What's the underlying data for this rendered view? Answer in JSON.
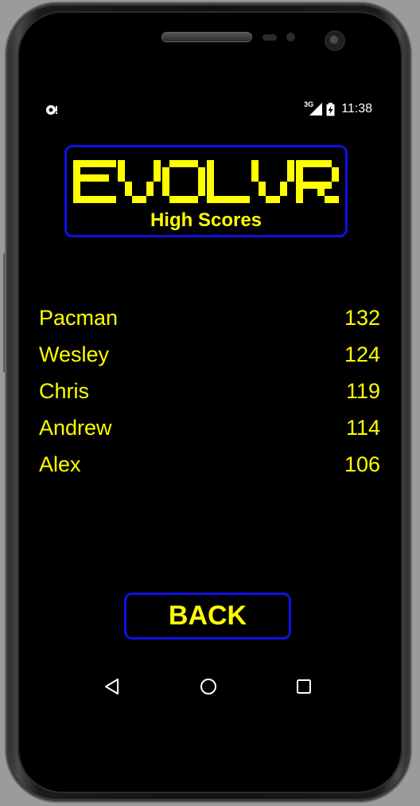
{
  "status_bar": {
    "left_icon": "debug-notification-icon",
    "network_label": "3G",
    "signal_icon": "signal-icon",
    "battery_icon": "battery-charging-icon",
    "time": "11:38"
  },
  "header": {
    "logo_text": "EVOLVR",
    "subtitle": "High Scores",
    "accent_color": "#ffff00",
    "border_color": "#1010e8"
  },
  "scores": [
    {
      "name": "Pacman",
      "score": "132"
    },
    {
      "name": "Wesley",
      "score": "124"
    },
    {
      "name": "Chris",
      "score": "119"
    },
    {
      "name": "Andrew",
      "score": "114"
    },
    {
      "name": "Alex",
      "score": "106"
    }
  ],
  "back_button": {
    "label": "BACK"
  },
  "nav_bar": {
    "back_icon": "triangle-back-icon",
    "home_icon": "circle-home-icon",
    "recents_icon": "square-recents-icon"
  }
}
